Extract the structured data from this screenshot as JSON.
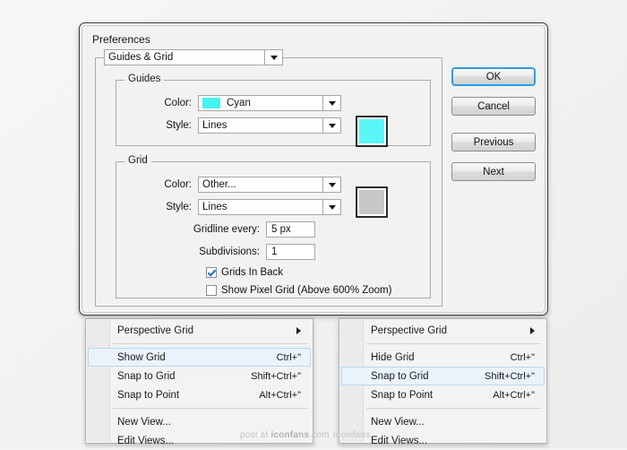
{
  "dialog": {
    "title": "Preferences",
    "section_select": {
      "value": "Guides & Grid"
    },
    "guides": {
      "legend": "Guides",
      "color_label": "Color:",
      "color_value": "Cyan",
      "color_hex": "#45F2F2",
      "style_label": "Style:",
      "style_value": "Lines",
      "swatch_hex": "#5BF7F7"
    },
    "grid": {
      "legend": "Grid",
      "color_label": "Color:",
      "color_value": "Other...",
      "style_label": "Style:",
      "style_value": "Lines",
      "gridline_label": "Gridline every:",
      "gridline_value": "5 px",
      "subdivisions_label": "Subdivisions:",
      "subdivisions_value": "1",
      "swatch_hex": "#C7C7C7",
      "grids_in_back": {
        "label": "Grids In Back",
        "checked": true
      },
      "show_pixel_grid": {
        "label": "Show Pixel Grid (Above 600% Zoom)",
        "checked": false
      }
    },
    "buttons": {
      "ok": "OK",
      "cancel": "Cancel",
      "previous": "Previous",
      "next": "Next"
    },
    "accent_focus_hex": "#2E9FE0"
  },
  "menu_left": {
    "items": [
      {
        "label": "Perspective Grid",
        "accel": "",
        "submenu": true,
        "highlighted": false
      },
      {
        "label": "Show Grid",
        "accel": "Ctrl+\"",
        "submenu": false,
        "highlighted": true
      },
      {
        "label": "Snap to Grid",
        "accel": "Shift+Ctrl+\"",
        "submenu": false,
        "highlighted": false
      },
      {
        "label": "Snap to Point",
        "accel": "Alt+Ctrl+\"",
        "submenu": false,
        "highlighted": false
      },
      {
        "label": "New View...",
        "accel": "",
        "submenu": false,
        "highlighted": false
      },
      {
        "label": "Edit Views...",
        "accel": "",
        "submenu": false,
        "highlighted": false
      }
    ]
  },
  "menu_right": {
    "items": [
      {
        "label": "Perspective Grid",
        "accel": "",
        "submenu": true,
        "highlighted": false
      },
      {
        "label": "Hide Grid",
        "accel": "Ctrl+\"",
        "submenu": false,
        "highlighted": false
      },
      {
        "label": "Snap to Grid",
        "accel": "Shift+Ctrl+\"",
        "submenu": false,
        "highlighted": true
      },
      {
        "label": "Snap to Point",
        "accel": "Alt+Ctrl+\"",
        "submenu": false,
        "highlighted": false
      },
      {
        "label": "New View...",
        "accel": "",
        "submenu": false,
        "highlighted": false
      },
      {
        "label": "Edit Views...",
        "accel": "",
        "submenu": false,
        "highlighted": false
      }
    ]
  },
  "watermark": {
    "prefix": "post at ",
    "brand": "iconfans",
    "suffix": ".com",
    "logo": "iconfans"
  }
}
